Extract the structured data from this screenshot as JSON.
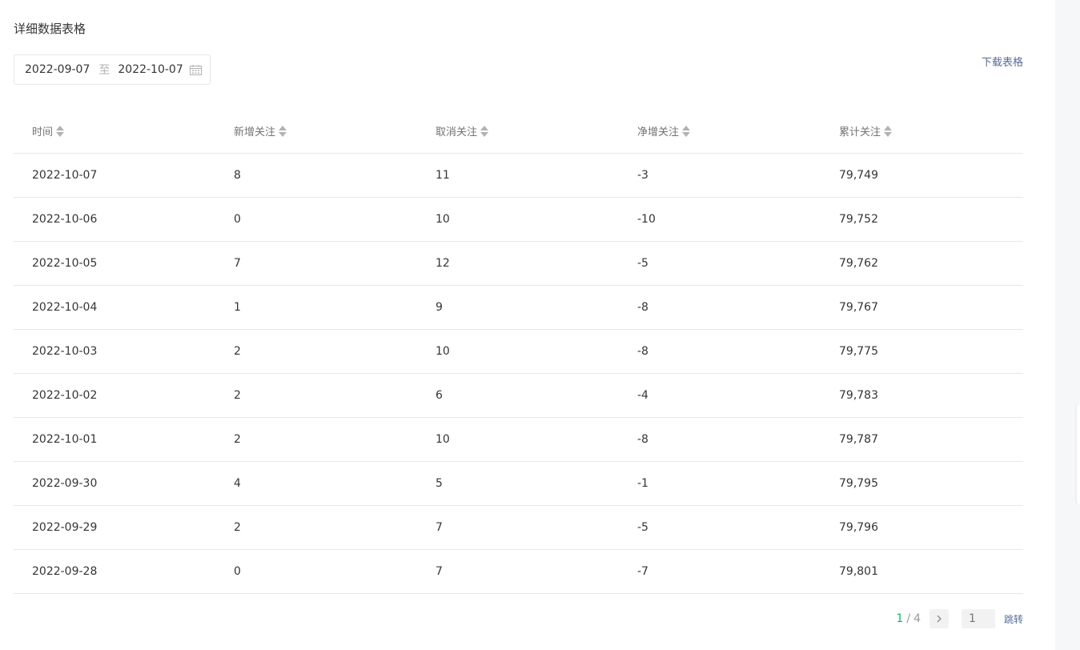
{
  "section": {
    "title": "详细数据表格"
  },
  "date_range": {
    "start": "2022-09-07",
    "separator": "至",
    "end": "2022-10-07"
  },
  "download": {
    "label": "下载表格"
  },
  "table": {
    "headers": [
      "时间",
      "新增关注",
      "取消关注",
      "净增关注",
      "累计关注"
    ],
    "rows": [
      [
        "2022-10-07",
        "8",
        "11",
        "-3",
        "79,749"
      ],
      [
        "2022-10-06",
        "0",
        "10",
        "-10",
        "79,752"
      ],
      [
        "2022-10-05",
        "7",
        "12",
        "-5",
        "79,762"
      ],
      [
        "2022-10-04",
        "1",
        "9",
        "-8",
        "79,767"
      ],
      [
        "2022-10-03",
        "2",
        "10",
        "-8",
        "79,775"
      ],
      [
        "2022-10-02",
        "2",
        "6",
        "-4",
        "79,783"
      ],
      [
        "2022-10-01",
        "2",
        "10",
        "-8",
        "79,787"
      ],
      [
        "2022-09-30",
        "4",
        "5",
        "-1",
        "79,795"
      ],
      [
        "2022-09-29",
        "2",
        "7",
        "-5",
        "79,796"
      ],
      [
        "2022-09-28",
        "0",
        "7",
        "-7",
        "79,801"
      ]
    ]
  },
  "pagination": {
    "current": "1",
    "separator": "/",
    "total": "4",
    "input_placeholder": "1",
    "jump_label": "跳转"
  },
  "icons": {
    "calendar": "calendar-icon",
    "sort": "sort-icon",
    "next": "chevron-right-icon"
  },
  "colors": {
    "accent_green": "#07c160",
    "link_blue": "#576b95",
    "border": "#e7e7eb"
  }
}
